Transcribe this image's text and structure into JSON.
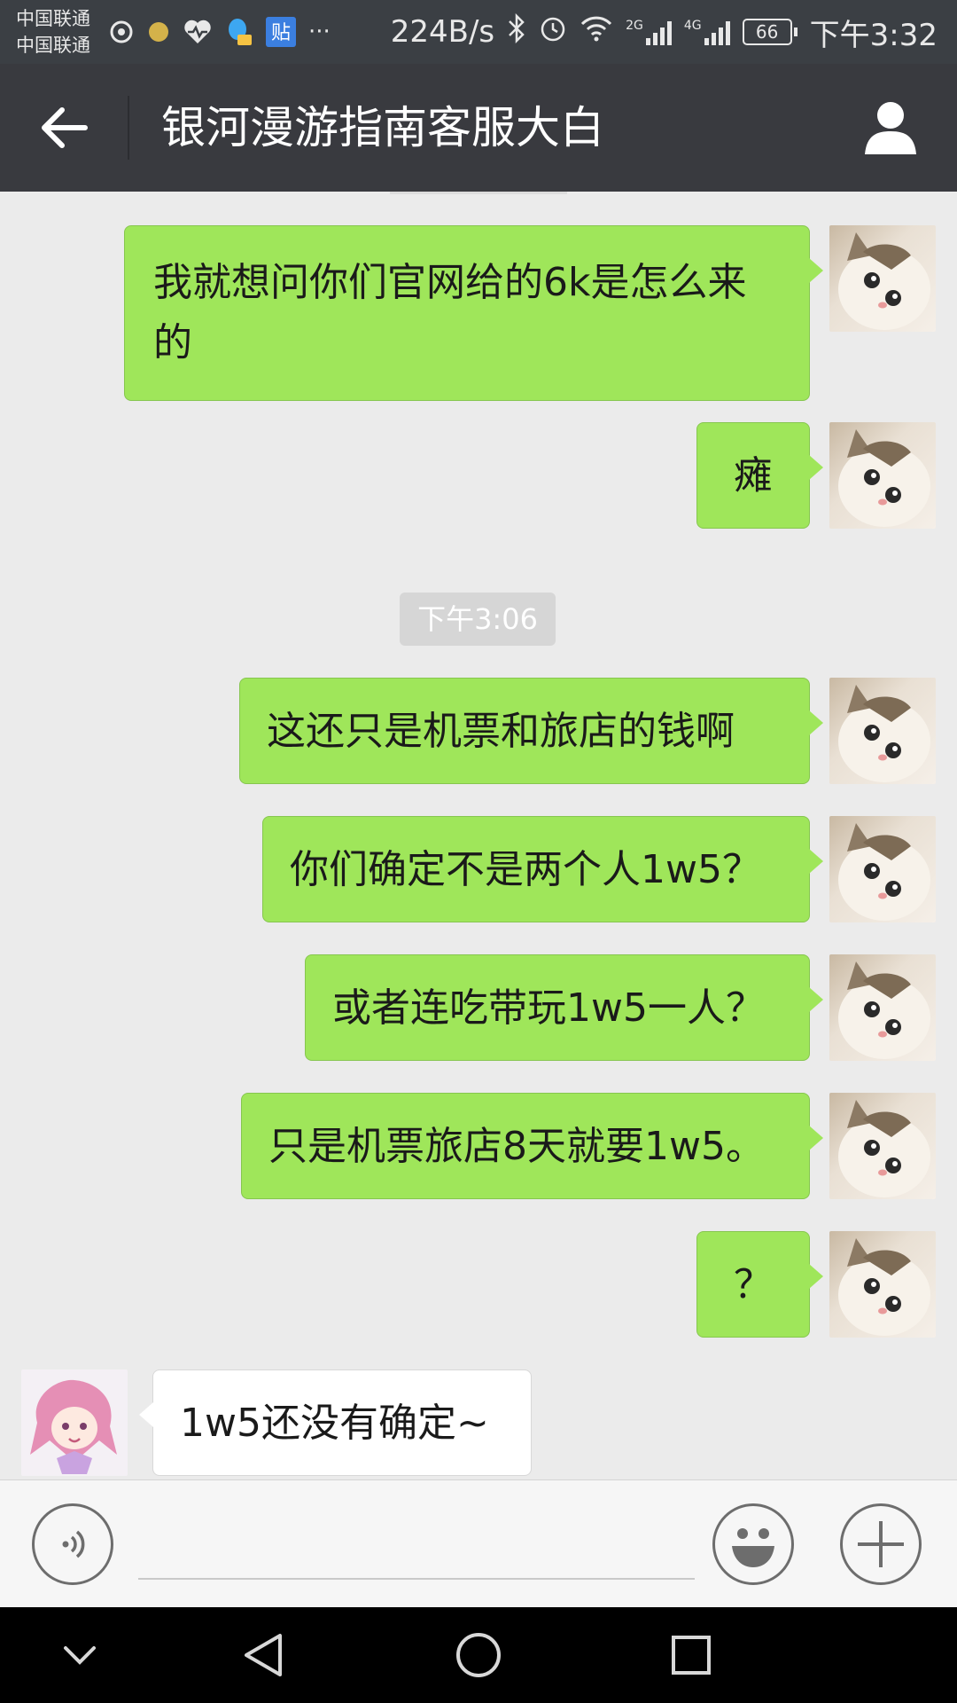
{
  "status_bar": {
    "carrier_1": "中国联通",
    "carrier_2": "中国联通",
    "net_speed": "224B/s",
    "signal_1_label": "2G",
    "signal_2_label": "4G",
    "battery": "66",
    "time": "下午3:32",
    "more": "···",
    "icons": [
      "netease-music-icon",
      "notification-dot-icon",
      "health-icon",
      "qq-icon",
      "tieba-icon",
      "bluetooth-icon",
      "alarm-icon",
      "wifi-icon"
    ]
  },
  "header": {
    "title": "银河漫游指南客服大白",
    "back_icon": "back-arrow-icon",
    "profile_icon": "contact-profile-icon"
  },
  "messages": [
    {
      "side": "out",
      "text": "我就想问你们官网给的6k是怎么来的"
    },
    {
      "side": "out",
      "text": "瘫"
    },
    {
      "type": "timestamp",
      "text": "下午3:06"
    },
    {
      "side": "out",
      "text": "这还只是机票和旅店的钱啊"
    },
    {
      "side": "out",
      "text": "你们确定不是两个人1w5？"
    },
    {
      "side": "out",
      "text": "或者连吃带玩1w5一人？"
    },
    {
      "side": "out",
      "text": "只是机票旅店8天就要1w5。"
    },
    {
      "side": "out",
      "text": "？"
    },
    {
      "side": "in",
      "text": "1w5还没有确定~"
    }
  ],
  "input_bar": {
    "voice_icon": "voice-input-icon",
    "emoji_icon": "emoji-icon",
    "more_icon": "plus-icon",
    "value": ""
  },
  "nav_bar": {
    "icons": [
      "collapse-icon",
      "nav-back-icon",
      "home-icon",
      "recents-icon"
    ]
  },
  "colors": {
    "titlebar": "#393a3f",
    "outgoing_bubble": "#9fe65a",
    "incoming_bubble": "#ffffff",
    "chat_bg": "#ebebeb"
  }
}
